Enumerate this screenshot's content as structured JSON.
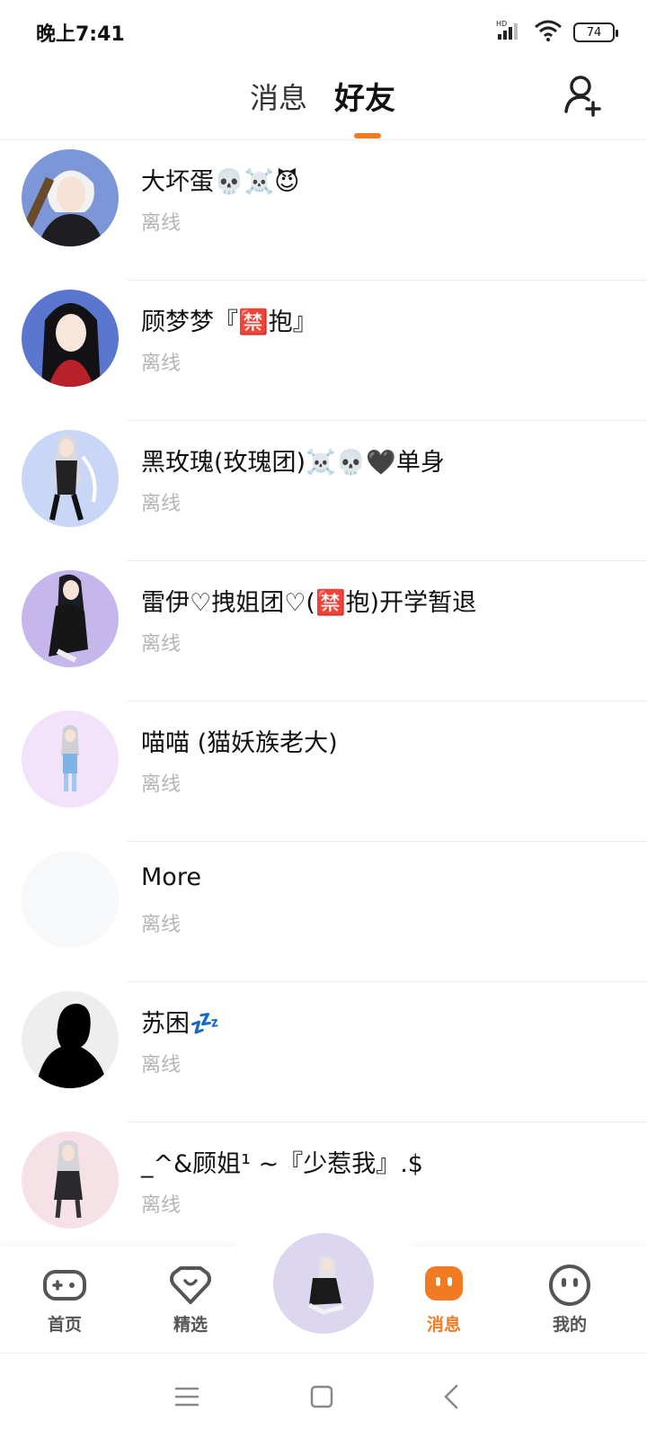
{
  "status_bar": {
    "time": "晚上7:41",
    "network": "HD",
    "battery": "74"
  },
  "header": {
    "tab_messages": "消息",
    "tab_friends": "好友",
    "active_tab": "好友",
    "accent_color": "#f07b22"
  },
  "friends": [
    {
      "name": "大坏蛋💀☠️😈",
      "status": "离线",
      "avatar_bg": "#7c96d8"
    },
    {
      "name": "顾梦梦『🈲抱』",
      "status": "离线",
      "avatar_bg": "#5b76cf"
    },
    {
      "name": "黑玫瑰(玫瑰团)☠️💀🖤单身",
      "status": "离线",
      "avatar_bg": "#c9d6f5"
    },
    {
      "name": "雷伊♡拽姐团♡(🈲抱)开学暂退",
      "status": "离线",
      "avatar_bg": "#c5b6ec"
    },
    {
      "name": "喵喵 (猫妖族老大)",
      "status": "离线",
      "avatar_bg": "#f2e3fb"
    },
    {
      "name": "More",
      "status": "离线",
      "avatar_bg": "#f7f8fa"
    },
    {
      "name": "苏困💤",
      "status": "离线",
      "avatar_bg": "#efeeef"
    },
    {
      "name": "_^&顾姐¹ ~『少惹我』.$",
      "status": "离线",
      "avatar_bg": "#f6e1e6"
    }
  ],
  "bottom_nav": {
    "items": [
      {
        "label": "首页",
        "icon": "gamepad-icon"
      },
      {
        "label": "精选",
        "icon": "heart-badge-icon"
      },
      {
        "label": "消息",
        "icon": "message-icon",
        "active": true
      },
      {
        "label": "我的",
        "icon": "face-icon"
      }
    ]
  }
}
